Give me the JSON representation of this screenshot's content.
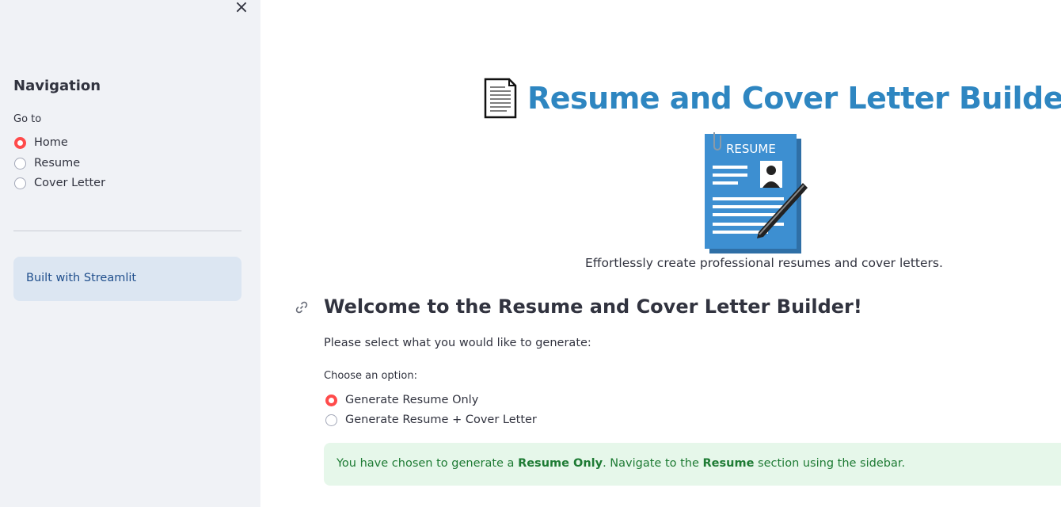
{
  "sidebar": {
    "close_glyph": "×",
    "nav_title": "Navigation",
    "goto_label": "Go to",
    "options": [
      {
        "label": "Home",
        "selected": true
      },
      {
        "label": "Resume",
        "selected": false
      },
      {
        "label": "Cover Letter",
        "selected": false
      }
    ],
    "info_text": "Built with Streamlit"
  },
  "main": {
    "title": "Resume and Cover Letter Builder",
    "title_icon": "page-document-icon",
    "image_text": "RESUME",
    "tagline": "Effortlessly create professional resumes and cover letters.",
    "welcome_heading": "Welcome to the Resume and Cover Letter Builder!",
    "prompt": "Please select what you would like to generate:",
    "choose_label": "Choose an option:",
    "options": [
      {
        "label": "Generate Resume Only",
        "selected": true
      },
      {
        "label": "Generate Resume + Cover Letter",
        "selected": false
      }
    ],
    "success": {
      "prefix": "You have chosen to generate a ",
      "choice": "Resume Only",
      "middle": ". Navigate to the ",
      "section": "Resume",
      "suffix": " section using the sidebar."
    }
  },
  "colors": {
    "title_blue": "#2e86c1",
    "radio_red": "#ff4b4b",
    "sidebar_bg": "#f0f2f6",
    "success_bg": "#e6f7ea",
    "success_text": "#1e7b34",
    "info_bg": "#dce6f2"
  }
}
